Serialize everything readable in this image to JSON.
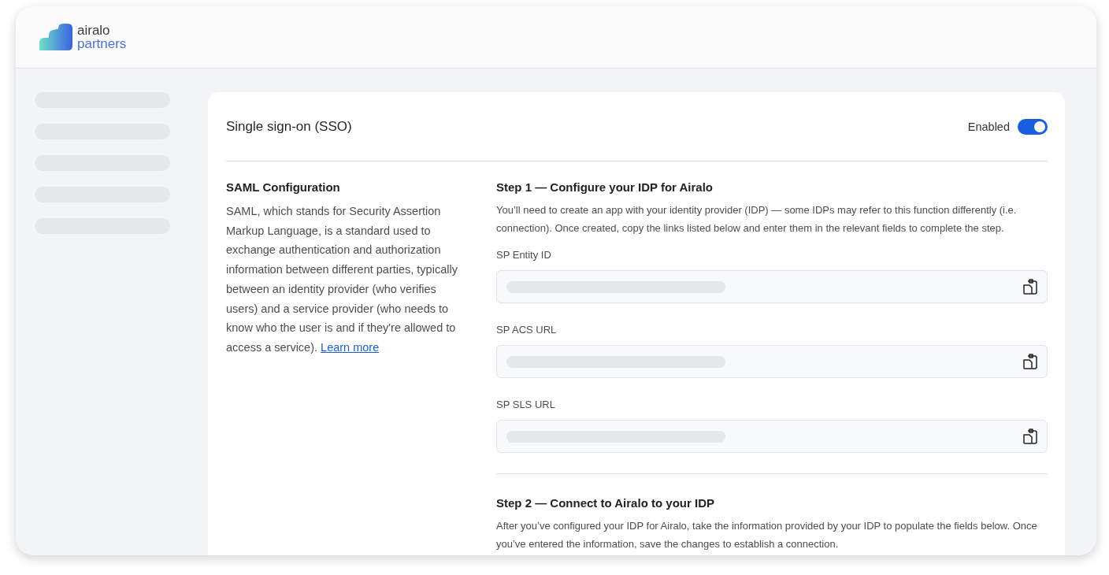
{
  "header": {
    "logo_top": "airalo",
    "logo_bottom": "partners"
  },
  "card": {
    "title": "Single sign-on (SSO)",
    "toggle": {
      "label": "Enabled",
      "on": true
    },
    "saml": {
      "title": "SAML Configuration",
      "text": "SAML, which stands for Security Assertion Markup Language, is a standard used to exchange authentication and authorization information between different parties, typically between an identity provider (who verifies users) and a service provider (who needs to know who the user is and if they're allowed to access a service).",
      "link": "Learn more"
    },
    "step1": {
      "title": "Step 1 — Configure your IDP for Airalo",
      "text": "You’ll need to create an app with your identity provider (IDP) —  some IDPs may refer to this function differently (i.e. connection). Once created, copy the links listed below and enter them in the relevant fields to complete the step.",
      "fields": [
        {
          "label": "SP Entity ID"
        },
        {
          "label": "SP ACS URL"
        },
        {
          "label": "SP SLS URL"
        }
      ]
    },
    "step2": {
      "title": "Step 2 — Connect to Airalo to your IDP",
      "text": "After you’ve configured your IDP for Airalo, take the information provided by your IDP to populate the fields below. Once you’ve entered the information, save the changes to establish a connection."
    }
  }
}
